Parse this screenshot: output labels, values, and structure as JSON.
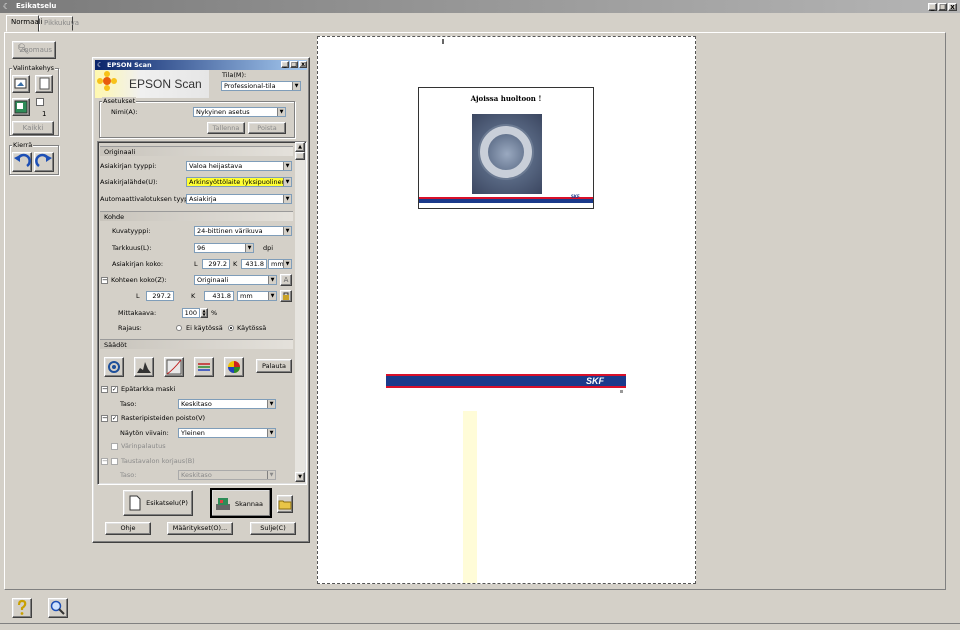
{
  "window": {
    "title": "Esikatselu",
    "controls": [
      "_",
      "□",
      "x"
    ]
  },
  "tabs": [
    {
      "label": "Normaali"
    },
    {
      "label": "Pikkukuva"
    }
  ],
  "toolbar": {
    "zoom_label": "Zoomaus",
    "marquee_group_label": "Valintakehys",
    "marquee_count": "1",
    "delete_label": "Kaikki",
    "rotate_group_label": "Kierrä"
  },
  "dialog": {
    "title": "EPSON Scan",
    "logo_text": "EPSON Scan",
    "mode_label": "Tila(M):",
    "mode_value": "Professional-tila",
    "settings": {
      "group_label": "Asetukset",
      "name_label": "Nimi(A):",
      "name_value": "Nykyinen asetus",
      "save_label": "Tallenna",
      "delete_label": "Poista"
    },
    "original": {
      "header": "Originaali",
      "doc_type_label": "Asiakirjan tyyppi:",
      "doc_type_value": "Valoa heijastava",
      "doc_source_label": "Asiakirjalähde(U):",
      "doc_source_value": "Arkinsyöttölaite (yksipuolinen)",
      "auto_exposure_label": "Automaattivalotuksen tyyppi(X):",
      "auto_exposure_value": "Asiakirja"
    },
    "target": {
      "header": "Kohde",
      "image_type_label": "Kuvatyyppi:",
      "image_type_value": "24-bittinen värikuva",
      "resolution_label": "Tarkkuus(L):",
      "resolution_value": "96",
      "resolution_unit": "dpi",
      "doc_size_label": "Asiakirjan koko:",
      "doc_size_w_label": "L",
      "doc_size_w": "297.2",
      "doc_size_h_label": "K",
      "doc_size_h": "431.8",
      "doc_size_unit": "mm",
      "target_size_label": "Kohteen koko(Z):",
      "target_size_value": "Originaali",
      "target_w_label": "L",
      "target_w": "297.2",
      "target_h_label": "K",
      "target_h": "431.8",
      "target_unit": "mm",
      "scale_label": "Mittakaava:",
      "scale_value": "100",
      "scale_unit": "%",
      "trim_label": "Rajaus:",
      "trim_off": "Ei käytössä",
      "trim_on": "Käytössä"
    },
    "adjustments": {
      "header": "Säädöt",
      "reset_label": "Palauta",
      "unsharp_label": "Epätarkka maski",
      "unsharp_level_label": "Taso:",
      "unsharp_level_value": "Keskitaso",
      "descreen_label": "Rasteripisteiden poisto(V)",
      "descreen_screen_label": "Näytön viivain:",
      "descreen_screen_value": "Yleinen",
      "color_restore_label": "Värinpalautus",
      "backlight_label": "Taustavalon korjaus(B)",
      "backlight_level_label": "Taso:",
      "backlight_level_value": "Keskitaso"
    },
    "buttons": {
      "preview": "Esikatselu(P)",
      "scan": "Skannaa",
      "help": "Ohje",
      "config": "Määritykset(O)...",
      "close": "Sulje(C)"
    }
  },
  "preview": {
    "doc_title": "Ajoissa huoltoon !",
    "brand": "SKF",
    "brand_small": "SKF"
  },
  "colors": {
    "highlight": "#ffff33",
    "skf_blue": "#1b3a8b",
    "skf_red": "#d8102a"
  }
}
